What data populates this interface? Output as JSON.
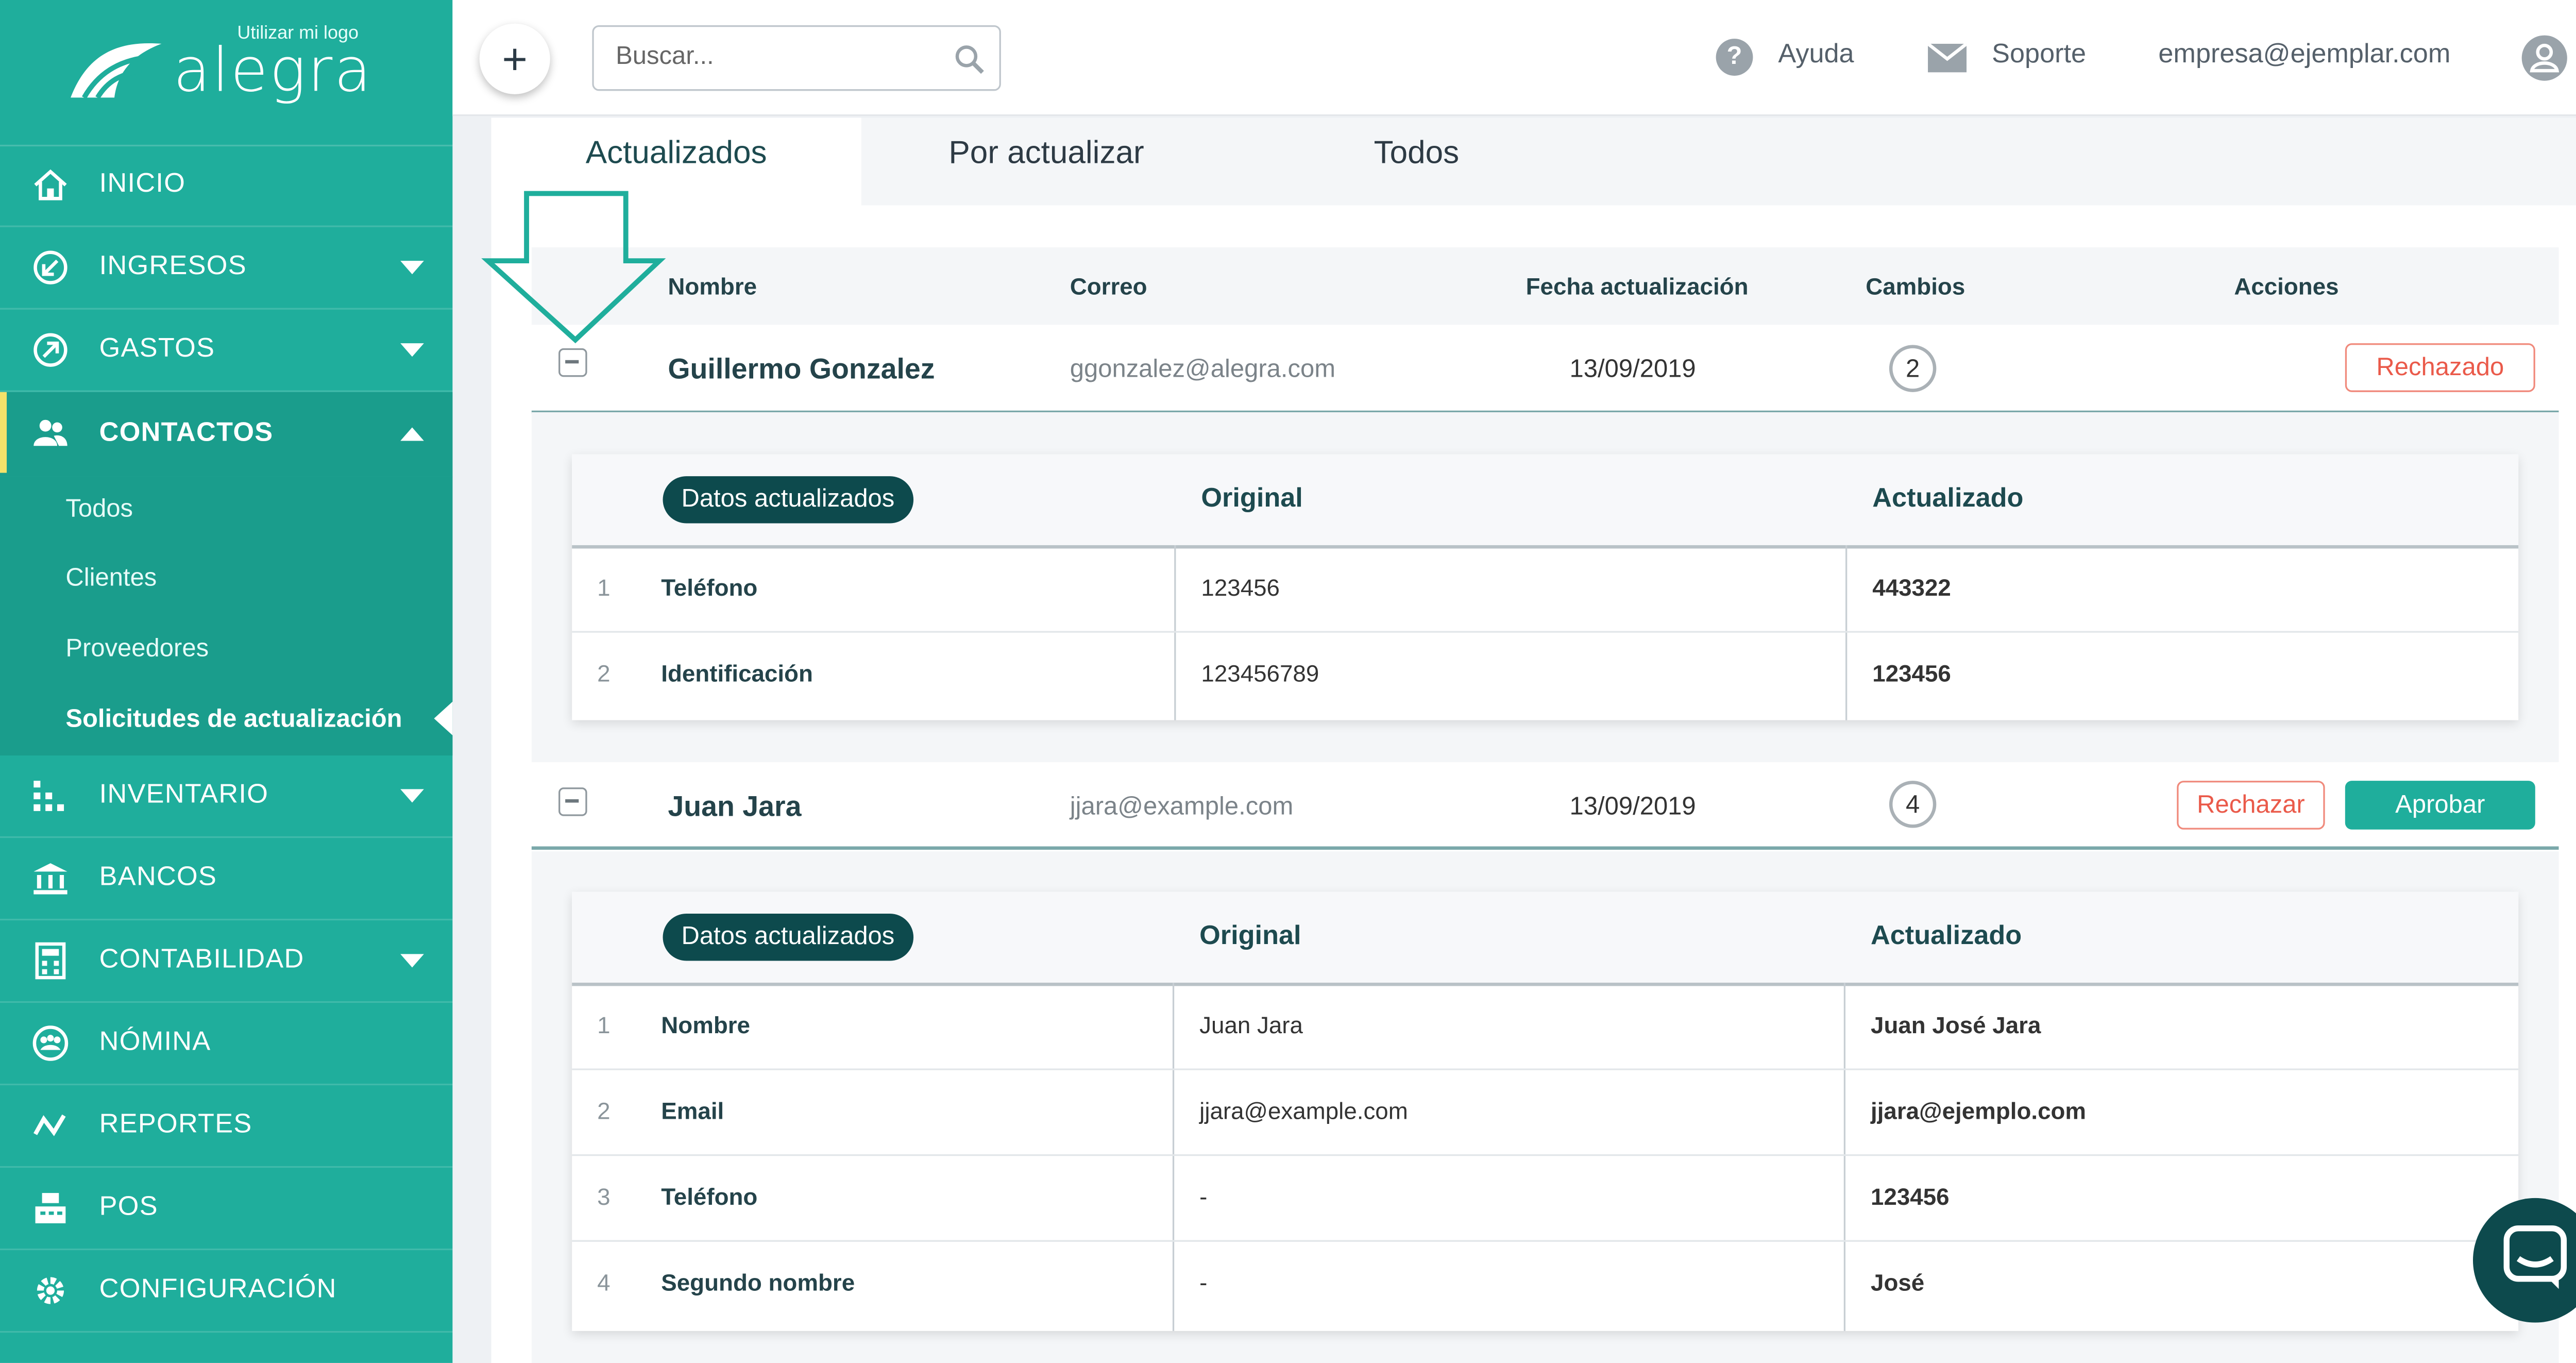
{
  "brand": {
    "logo_tagline": "Utilizar mi logo",
    "logo_text": "alegra",
    "accent": "#1fae9c",
    "dark": "#0d4a4d"
  },
  "sidebar": {
    "items": [
      {
        "label": "INICIO",
        "icon": "home-icon"
      },
      {
        "label": "INGRESOS",
        "icon": "income-icon"
      },
      {
        "label": "GASTOS",
        "icon": "expense-icon"
      },
      {
        "label": "CONTACTOS",
        "icon": "contacts-icon"
      },
      {
        "label": "INVENTARIO",
        "icon": "inventory-icon"
      },
      {
        "label": "BANCOS",
        "icon": "bank-icon"
      },
      {
        "label": "CONTABILIDAD",
        "icon": "accounting-icon"
      },
      {
        "label": "NÓMINA",
        "icon": "payroll-icon"
      },
      {
        "label": "REPORTES",
        "icon": "reports-icon"
      },
      {
        "label": "POS",
        "icon": "pos-icon"
      },
      {
        "label": "CONFIGURACIÓN",
        "icon": "gear-icon"
      }
    ],
    "contactos_sub": [
      "Todos",
      "Clientes",
      "Proveedores",
      "Solicitudes de actualización"
    ]
  },
  "topbar": {
    "search_placeholder": "Buscar...",
    "help": "Ayuda",
    "support": "Soporte",
    "email": "empresa@ejemplar.com"
  },
  "tabs": [
    "Actualizados",
    "Por actualizar",
    "Todos"
  ],
  "table": {
    "headers": [
      "Nombre",
      "Correo",
      "Fecha actualización",
      "Cambios",
      "Acciones"
    ],
    "rows": [
      {
        "name": "Guillermo Gonzalez",
        "email": "ggonzalez@alegra.com",
        "date": "13/09/2019",
        "changes": "2",
        "status": "Rechazado",
        "detail_title": "Datos actualizados",
        "col_original": "Original",
        "col_updated": "Actualizado",
        "details": [
          {
            "n": "1",
            "field": "Teléfono",
            "original": "123456",
            "updated": "443322"
          },
          {
            "n": "2",
            "field": "Identificación",
            "original": "123456789",
            "updated": "123456"
          }
        ]
      },
      {
        "name": "Juan Jara",
        "email": "jjara@example.com",
        "date": "13/09/2019",
        "changes": "4",
        "reject": "Rechazar",
        "approve": "Aprobar",
        "detail_title": "Datos actualizados",
        "col_original": "Original",
        "col_updated": "Actualizado",
        "details": [
          {
            "n": "1",
            "field": "Nombre",
            "original": "Juan Jara",
            "updated": "Juan José Jara"
          },
          {
            "n": "2",
            "field": "Email",
            "original": "jjara@example.com",
            "updated": "jjara@ejemplo.com"
          },
          {
            "n": "3",
            "field": "Teléfono",
            "original": "-",
            "updated": "123456"
          },
          {
            "n": "4",
            "field": "Segundo nombre",
            "original": "-",
            "updated": "José"
          }
        ]
      }
    ]
  }
}
